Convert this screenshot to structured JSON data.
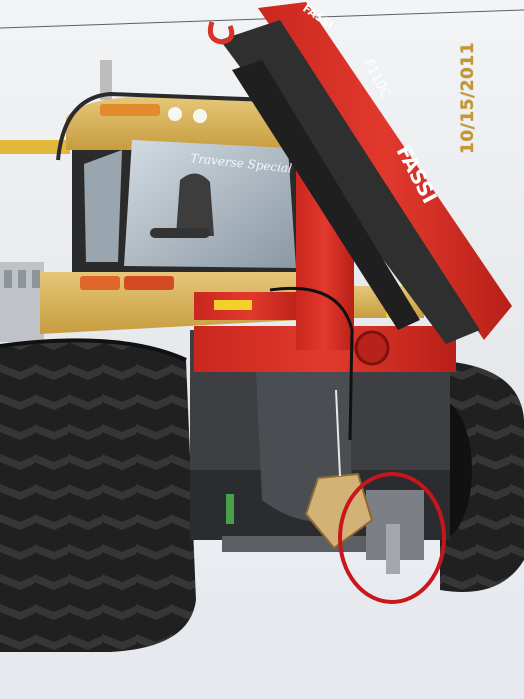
{
  "photo": {
    "date_stamp": "10/15/2011",
    "cab_script": "Traverse Special",
    "crane_brand": "FASSI",
    "crane_model": "F110C",
    "highlight_color": "#c8161d"
  },
  "colors": {
    "sky": "#eef0f3",
    "snow": "#f1f3f6",
    "track": "#1c1c1c",
    "crane_red": "#d9322a",
    "cab_yellow": "#d9b45a",
    "date_stamp": "#c8952c"
  }
}
